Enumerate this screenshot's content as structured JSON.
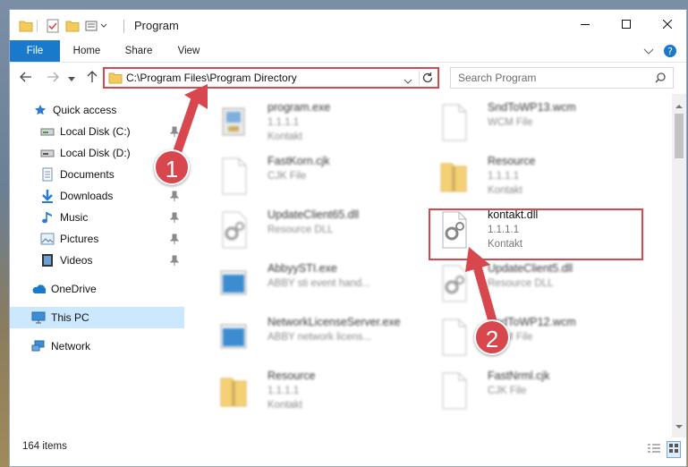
{
  "window": {
    "title": "Program",
    "controls": {
      "minimize_icon": "minimize-icon",
      "maximize_icon": "maximize-icon",
      "close_icon": "close-icon"
    }
  },
  "ribbon": {
    "tabs": [
      {
        "label": "File"
      },
      {
        "label": "Home"
      },
      {
        "label": "Share"
      },
      {
        "label": "View"
      }
    ]
  },
  "navigation": {
    "address": "C:\\Program Files\\Program Directory",
    "search_placeholder": "Search Program"
  },
  "sidebar": {
    "items": [
      {
        "label": "Quick access",
        "icon": "star-icon"
      },
      {
        "label": "Local Disk (C:)",
        "icon": "drive-icon",
        "pinned": true
      },
      {
        "label": "Local Disk (D:)",
        "icon": "drive-icon"
      },
      {
        "label": "Documents",
        "icon": "documents-icon"
      },
      {
        "label": "Downloads",
        "icon": "download-icon",
        "pinned": true
      },
      {
        "label": "Music",
        "icon": "music-icon",
        "pinned": true
      },
      {
        "label": "Pictures",
        "icon": "pictures-icon",
        "pinned": true
      },
      {
        "label": "Videos",
        "icon": "videos-icon",
        "pinned": true
      },
      {
        "label": "OneDrive",
        "icon": "cloud-icon"
      },
      {
        "label": "This PC",
        "icon": "computer-icon",
        "selected": true
      },
      {
        "label": "Network",
        "icon": "network-icon"
      }
    ]
  },
  "files": [
    {
      "name": "program.exe",
      "line1": "1.1.1.1",
      "line2": "Kontakt",
      "icon": "installer-icon"
    },
    {
      "name": "SndToWP13.wcm",
      "line1": "WCM File",
      "line2": "",
      "icon": "blank-file-icon"
    },
    {
      "name": "FastKorn.cjk",
      "line1": "CJK File",
      "line2": "",
      "icon": "blank-file-icon"
    },
    {
      "name": "Resource",
      "line1": "1.1.1.1",
      "line2": "Kontakt",
      "icon": "zip-icon"
    },
    {
      "name": "UpdateClient65.dll",
      "line1": "Resource DLL",
      "line2": "",
      "icon": "gear-file-icon"
    },
    {
      "name": "kontakt.dll",
      "line1": "1.1.1.1",
      "line2": "Kontakt",
      "icon": "gear-file-icon"
    },
    {
      "name": "AbbyySTI.exe",
      "line1": "ABBY sti event hand...",
      "line2": "",
      "icon": "app-icon"
    },
    {
      "name": "UpdateClient5.dll",
      "line1": "Resource DLL",
      "line2": "",
      "icon": "gear-file-icon"
    },
    {
      "name": "NetworkLicenseServer.exe",
      "line1": "ABBY network licens...",
      "line2": "",
      "icon": "app-icon"
    },
    {
      "name": "SndToWP12.wcm",
      "line1": "WCM File",
      "line2": "",
      "icon": "blank-file-icon"
    },
    {
      "name": "Resource",
      "line1": "1.1.1.1",
      "line2": "Kontakt",
      "icon": "zip-icon"
    },
    {
      "name": "FastNrml.cjk",
      "line1": "CJK File",
      "line2": "",
      "icon": "blank-file-icon"
    }
  ],
  "status": {
    "item_count": "164 items"
  },
  "annotations": {
    "step1": "1",
    "step2": "2"
  },
  "colors": {
    "accent": "#1979ca",
    "highlight": "#d9474e",
    "selected": "#cce8ff"
  }
}
